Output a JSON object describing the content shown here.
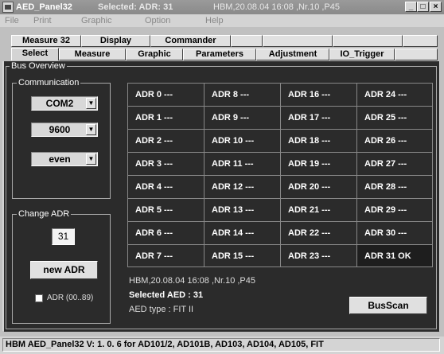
{
  "window": {
    "title": "AED_Panel32",
    "selected": "Selected:  ADR: 31",
    "subtitle": "HBM,20.08.04 16:08 ,Nr.10  ,P45",
    "min": "_",
    "max": "□",
    "close": "×"
  },
  "menu": [
    "File",
    "Print",
    "Graphic",
    "Option",
    "Help"
  ],
  "tabs_top": [
    "Measure 32",
    "Display",
    "Commander"
  ],
  "tabs_bottom": [
    "Select",
    "Measure",
    "Graphic",
    "Parameters",
    "Adjustment",
    "IO_Trigger"
  ],
  "bus_overview": {
    "legend": "Bus Overview",
    "communication": {
      "legend": "Communication",
      "port": "COM2",
      "baud": "9600",
      "parity": "even"
    },
    "change_adr": {
      "legend": "Change ADR",
      "value": "31",
      "button": "new ADR",
      "checkbox_label": "ADR (00..89)"
    },
    "cells": [
      [
        "ADR 0 ---",
        "ADR 8 ---",
        "ADR 16 ---",
        "ADR 24 ---"
      ],
      [
        "ADR 1 ---",
        "ADR 9 ---",
        "ADR 17 ---",
        "ADR 25 ---"
      ],
      [
        "ADR 2 ---",
        "ADR 10 ---",
        "ADR 18 ---",
        "ADR 26 ---"
      ],
      [
        "ADR 3 ---",
        "ADR 11 ---",
        "ADR 19 ---",
        "ADR 27 ---"
      ],
      [
        "ADR 4 ---",
        "ADR 12 ---",
        "ADR 20 ---",
        "ADR 28 ---"
      ],
      [
        "ADR 5 ---",
        "ADR 13 ---",
        "ADR 21 ---",
        "ADR 29 ---"
      ],
      [
        "ADR 6 ---",
        "ADR 14 ---",
        "ADR 22 ---",
        "ADR 30 ---"
      ],
      [
        "ADR 7 ---",
        "ADR 15 ---",
        "ADR 23 ---",
        "ADR 31   OK"
      ]
    ],
    "info_line": "HBM,20.08.04 16:08 ,Nr.10  ,P45",
    "selected_aed": "Selected AED : 31",
    "aed_type": "AED type : FIT II",
    "busscan_button": "BusScan"
  },
  "status": "HBM  AED_Panel32   V:  1. 0. 6    for AD101/2, AD101B, AD103, AD104, AD105, FIT"
}
